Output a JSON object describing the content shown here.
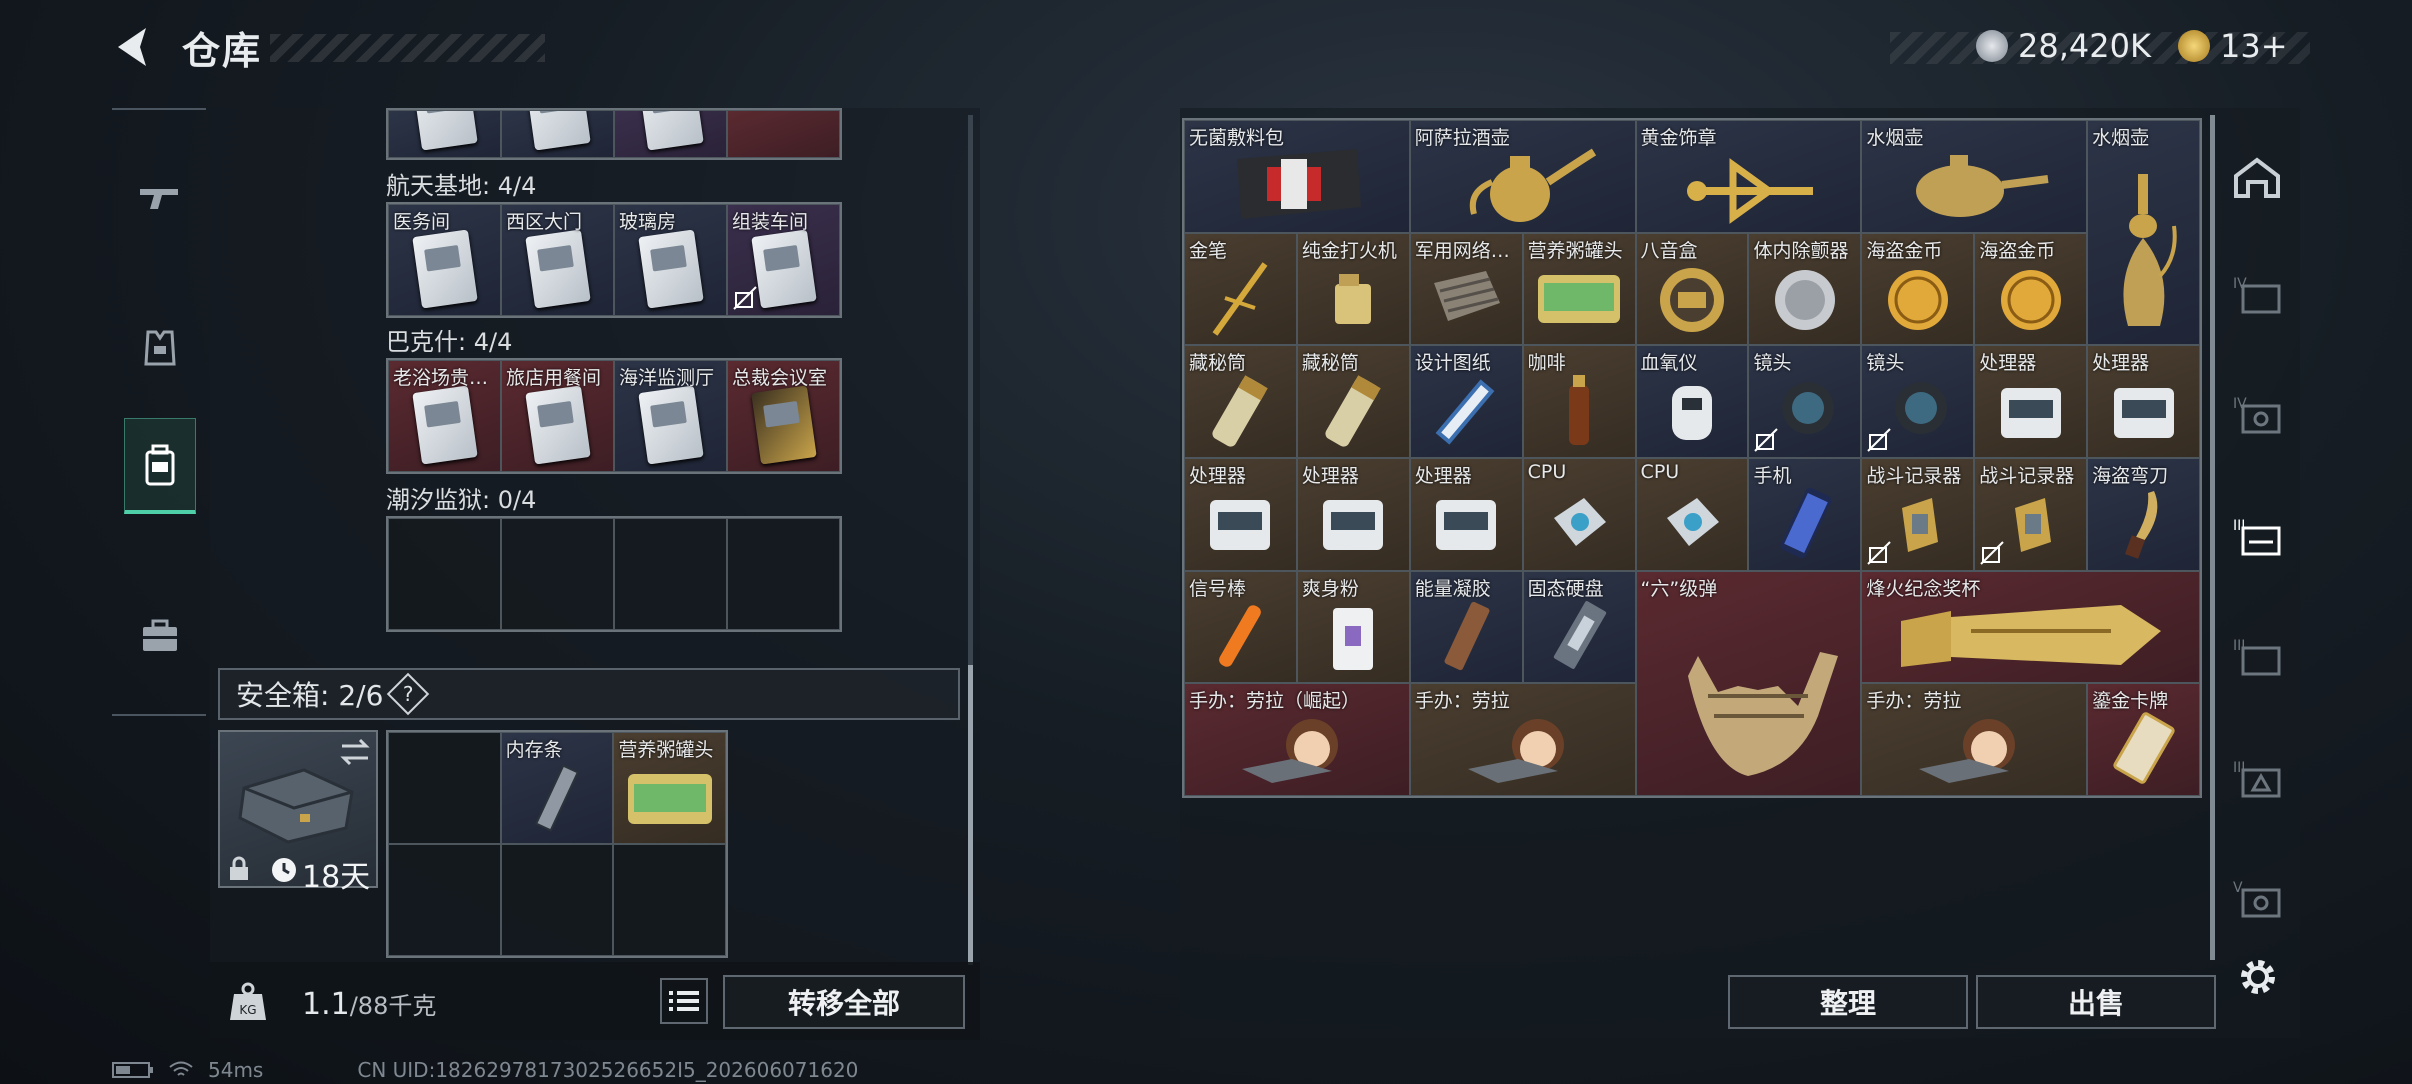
{
  "header": {
    "title": "仓库",
    "currency_a": "28,420K",
    "currency_b": "13+"
  },
  "left_tabs": [
    {
      "name": "weapons-tab",
      "icon": "gun-icon"
    },
    {
      "name": "equipment-tab",
      "icon": "vest-icon"
    },
    {
      "name": "storage-tab",
      "icon": "backpack-icon",
      "active": true
    },
    {
      "name": "case-tab",
      "icon": "briefcase-icon"
    }
  ],
  "keycards": {
    "sections": [
      {
        "label": "航天基地: 4/4",
        "items": [
          {
            "name": "医务间",
            "color": "blue",
            "locked": false
          },
          {
            "name": "西区大门",
            "color": "blue",
            "locked": false
          },
          {
            "name": "玻璃房",
            "color": "blue",
            "locked": false
          },
          {
            "name": "组装车间",
            "color": "purple",
            "locked": true
          }
        ]
      },
      {
        "label": "巴克什: 4/4",
        "items": [
          {
            "name": "老浴场贵…",
            "color": "red",
            "locked": false
          },
          {
            "name": "旅店用餐间",
            "color": "red",
            "locked": false
          },
          {
            "name": "海洋监测厅",
            "color": "blue",
            "locked": false
          },
          {
            "name": "总裁会议室",
            "color": "red",
            "locked": false,
            "gold": true
          }
        ]
      },
      {
        "label": "潮汐监狱: 0/4",
        "items": []
      }
    ]
  },
  "safe_box": {
    "label": "安全箱: 2/6",
    "help": "?",
    "duration": "18天",
    "items": [
      {
        "name": "",
        "color": "empty"
      },
      {
        "name": "内存条",
        "color": "blue"
      },
      {
        "name": "营养粥罐头",
        "color": "gold"
      },
      {
        "name": "",
        "color": "empty"
      },
      {
        "name": "",
        "color": "empty"
      },
      {
        "name": "",
        "color": "empty"
      }
    ]
  },
  "footer_left": {
    "weight_current": "1.1",
    "weight_max": "/88千克",
    "transfer_all": "转移全部"
  },
  "stash": {
    "rows": [
      [
        "无菌敷料包",
        "阿萨拉酒壶",
        "黄金饰章",
        "水烟壶",
        "水烟壶"
      ],
      [
        "金笔",
        "纯金打火机",
        "军用网络…",
        "营养粥罐头",
        "八音盒",
        "体内除颤器",
        "海盗金币",
        "海盗金币"
      ],
      [
        "藏秘筒",
        "藏秘筒",
        "设计图纸",
        "咖啡",
        "血氧仪",
        "镜头",
        "镜头",
        "处理器",
        "处理器"
      ],
      [
        "处理器",
        "处理器",
        "处理器",
        "CPU",
        "CPU",
        "手机",
        "战斗记录器",
        "战斗记录器",
        "海盗弯刀"
      ],
      [
        "信号棒",
        "爽身粉",
        "能量凝胶",
        "固态硬盘",
        "“六”级弹",
        "烽火纪念奖杯"
      ],
      [
        "手办：劳拉（崛起）",
        "手办：劳拉",
        "手办：劳拉",
        "鎏金卡牌"
      ]
    ]
  },
  "footer_right": {
    "sort": "整理",
    "sell": "出售"
  },
  "status": {
    "ping": "54ms",
    "uid": "CN UID:1826297817302526652I5_202606071620"
  }
}
